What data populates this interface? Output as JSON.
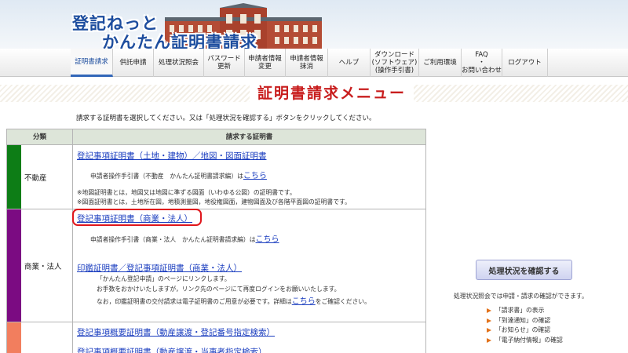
{
  "header": {
    "logo_line1": "登記ねっと",
    "logo_line2": "かんたん証明書請求"
  },
  "nav": {
    "items": [
      {
        "label": "証明書請求"
      },
      {
        "label": "供託申請"
      },
      {
        "label": "処理状況照会"
      },
      {
        "label": "パスワード\n更新"
      },
      {
        "label": "申請者情報\n変更"
      },
      {
        "label": "申請者情報\n抹消"
      },
      {
        "label": "ヘルプ"
      },
      {
        "label": "ダウンロード\n(ソフトウェア)\n(操作手引書)"
      },
      {
        "label": "ご利用環境"
      },
      {
        "label": "FAQ\n・\nお問い合わせ"
      },
      {
        "label": "ログアウト"
      }
    ]
  },
  "page_title": "証明書請求メニュー",
  "instruction": "請求する証明書を選択してください。又は「処理状況を確認する」ボタンをクリックしてください。",
  "table": {
    "header_category": "分類",
    "header_certificate": "請求する証明書",
    "real_estate": {
      "category": "不動産",
      "link": "登記事項証明書（土地・建物）／地図・図面証明書",
      "guide_prefix": "申請者操作手引書（不動産　かんたん証明書請求編）は",
      "guide_link": "こちら",
      "note1": "※地図証明書とは，地図又は地図に準ずる図面（いわゆる公図）の証明書です。",
      "note2": "※図面証明書とは，土地所在図，地積測量図，地役権図面，建物図面及び各階平面図の証明書です。"
    },
    "corporate": {
      "category": "商業・法人",
      "link": "登記事項証明書（商業・法人）",
      "guide_prefix": "申請者操作手引書（商業・法人　かんたん証明書請求編）は",
      "guide_link": "こちら",
      "seal_link": "印鑑証明書／登記事項証明書（商業・法人）",
      "seal_note1": "「かんたん登記申請」のページにリンクします。",
      "seal_note2": "お手数をおかけいたしますが，リンク先のページにて再度ログインをお願いいたします。",
      "seal_note3_prefix": "なお，印鑑証明書の交付請求は電子証明書のご用意が必要です。詳細は",
      "seal_note3_link": "こちら",
      "seal_note3_suffix": "をご確認ください。"
    },
    "movables": {
      "link1": "登記事項概要証明書（動産譲渡・登記番号指定検索）",
      "link2": "登記事項概要証明書（動産譲渡・当事者指定検索）"
    }
  },
  "status": {
    "button_label": "処理状況を確認する",
    "note": "処理状況照会では申請・請求の確認ができます。",
    "items": [
      "「請求書」の表示",
      "「到達通知」の確認",
      "「お知らせ」の確認",
      "「電子納付情報」の確認"
    ]
  },
  "colors": {
    "real_estate_bar": "#0d7d16",
    "corporate_bar": "#7b0b82",
    "movables_bar": "#f27e5e",
    "link": "#1a3dbf",
    "title": "#c81d1d",
    "highlight": "#e0161c"
  }
}
